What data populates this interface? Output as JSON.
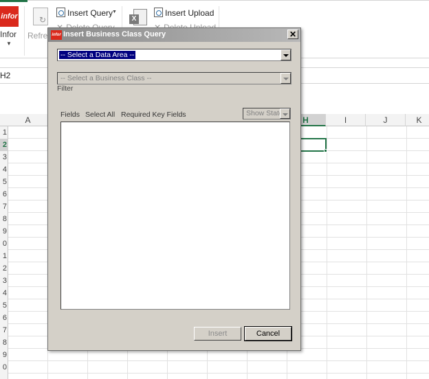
{
  "ribbon": {
    "infor_logo": "infor",
    "infor_label": "Infor",
    "refresh_label": "Refres",
    "insert_query_label": "Insert Query",
    "delete_query_label": "Delete Query",
    "insert_upload_label": "Insert Upload",
    "delete_upload_label": "Delete Upload",
    "dropdown_glyph": "▼"
  },
  "name_box": {
    "value": "H2"
  },
  "grid": {
    "columns": [
      "A",
      "",
      "",
      "",
      "",
      "",
      "",
      "H",
      "I",
      "J",
      "K"
    ],
    "active_column": "H",
    "rows": [
      "1",
      "2",
      "3",
      "4",
      "5",
      "6",
      "7",
      "8",
      "9",
      "0",
      "1",
      "2",
      "3",
      "4",
      "5",
      "6",
      "7",
      "8",
      "9",
      "0"
    ],
    "active_row_index": 1
  },
  "dialog": {
    "logo": "infor",
    "title": "Insert Business Class Query",
    "close_glyph": "✕",
    "data_area_select": "-- Select a Data Area --",
    "business_class_select": "-- Select a Business Class --",
    "filter_label": "Filter",
    "fields_label": "Fields",
    "select_all_label": "Select All",
    "required_key_fields_label": "Required Key Fields",
    "show_state_select": "Show State",
    "insert_button": "Insert",
    "cancel_button": "Cancel"
  },
  "colors": {
    "excel_green": "#217346",
    "infor_red": "#da291c",
    "dialog_face": "#d4d0c8",
    "selection_blue": "#000080"
  }
}
